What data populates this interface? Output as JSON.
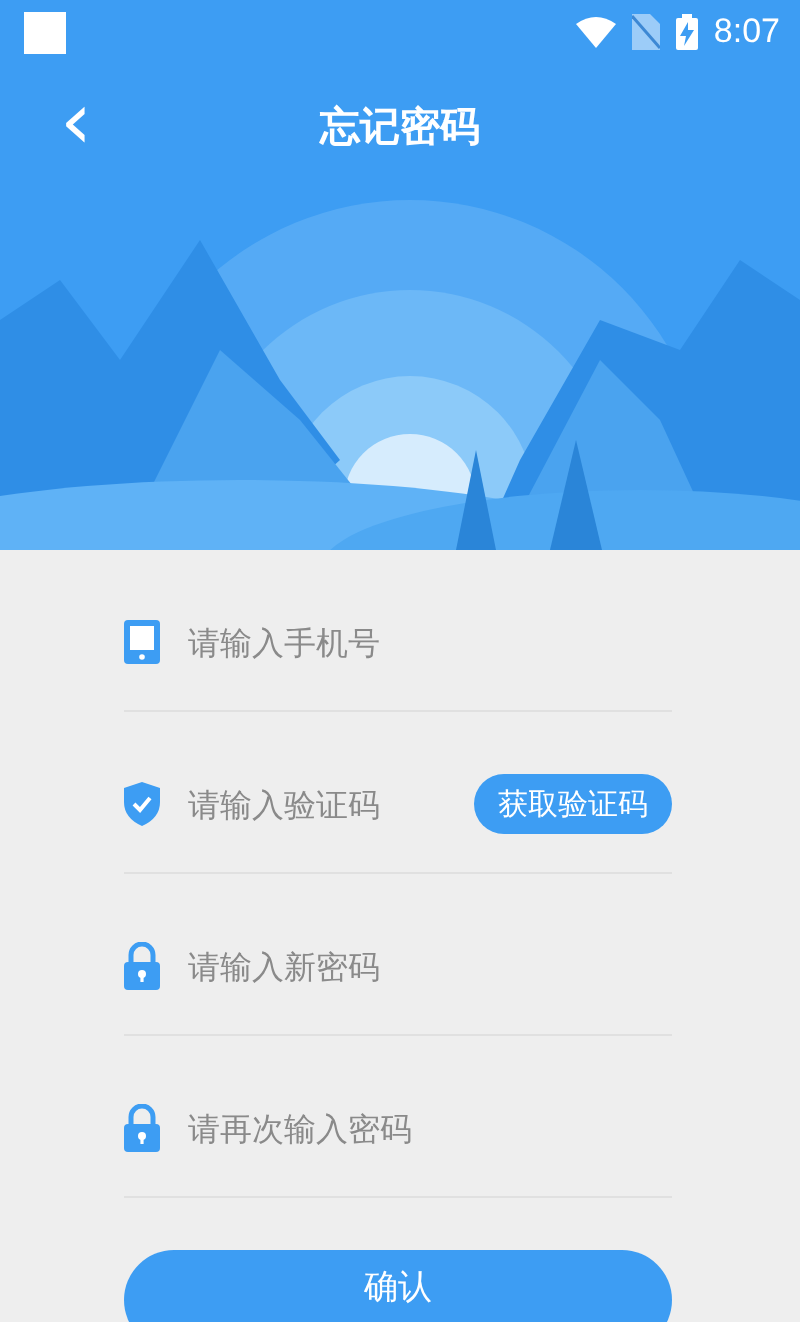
{
  "status_bar": {
    "time": "8:07"
  },
  "header": {
    "back": "‹",
    "title": "忘记密码"
  },
  "fields": [
    {
      "kind": "phone",
      "placeholder": "请输入手机号"
    },
    {
      "kind": "code",
      "placeholder": "请输入验证码",
      "button": "获取验证码"
    },
    {
      "kind": "lock",
      "placeholder": "请输入新密码"
    },
    {
      "kind": "lock",
      "placeholder": "请再次输入密码"
    }
  ],
  "confirm": "确认"
}
